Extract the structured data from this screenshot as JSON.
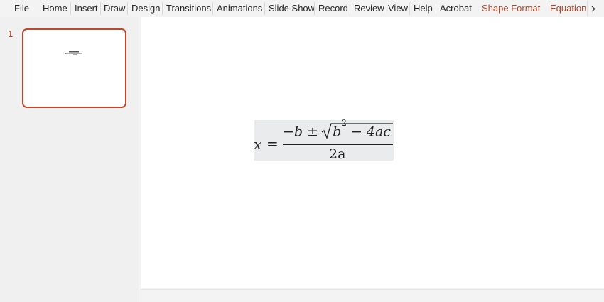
{
  "ribbon": {
    "tabs": [
      "File",
      "Home",
      "Insert",
      "Draw",
      "Design",
      "Transitions",
      "Animations",
      "Slide Show",
      "Record",
      "Review",
      "View",
      "Help",
      "Acrobat",
      "Shape Format",
      "Equation"
    ]
  },
  "thumbnails": {
    "slide_number": "1"
  },
  "equation": {
    "lhs": "x",
    "equals": "=",
    "numerator_prefix": "−b ± ",
    "radicand": "b",
    "radicand_exp": "2",
    "radicand_rest": " − 4ac",
    "denominator": "2a"
  },
  "colors": {
    "accent": "#b5472b",
    "selection_border": "#c0452d",
    "equation_highlight": "#e9ebec"
  }
}
